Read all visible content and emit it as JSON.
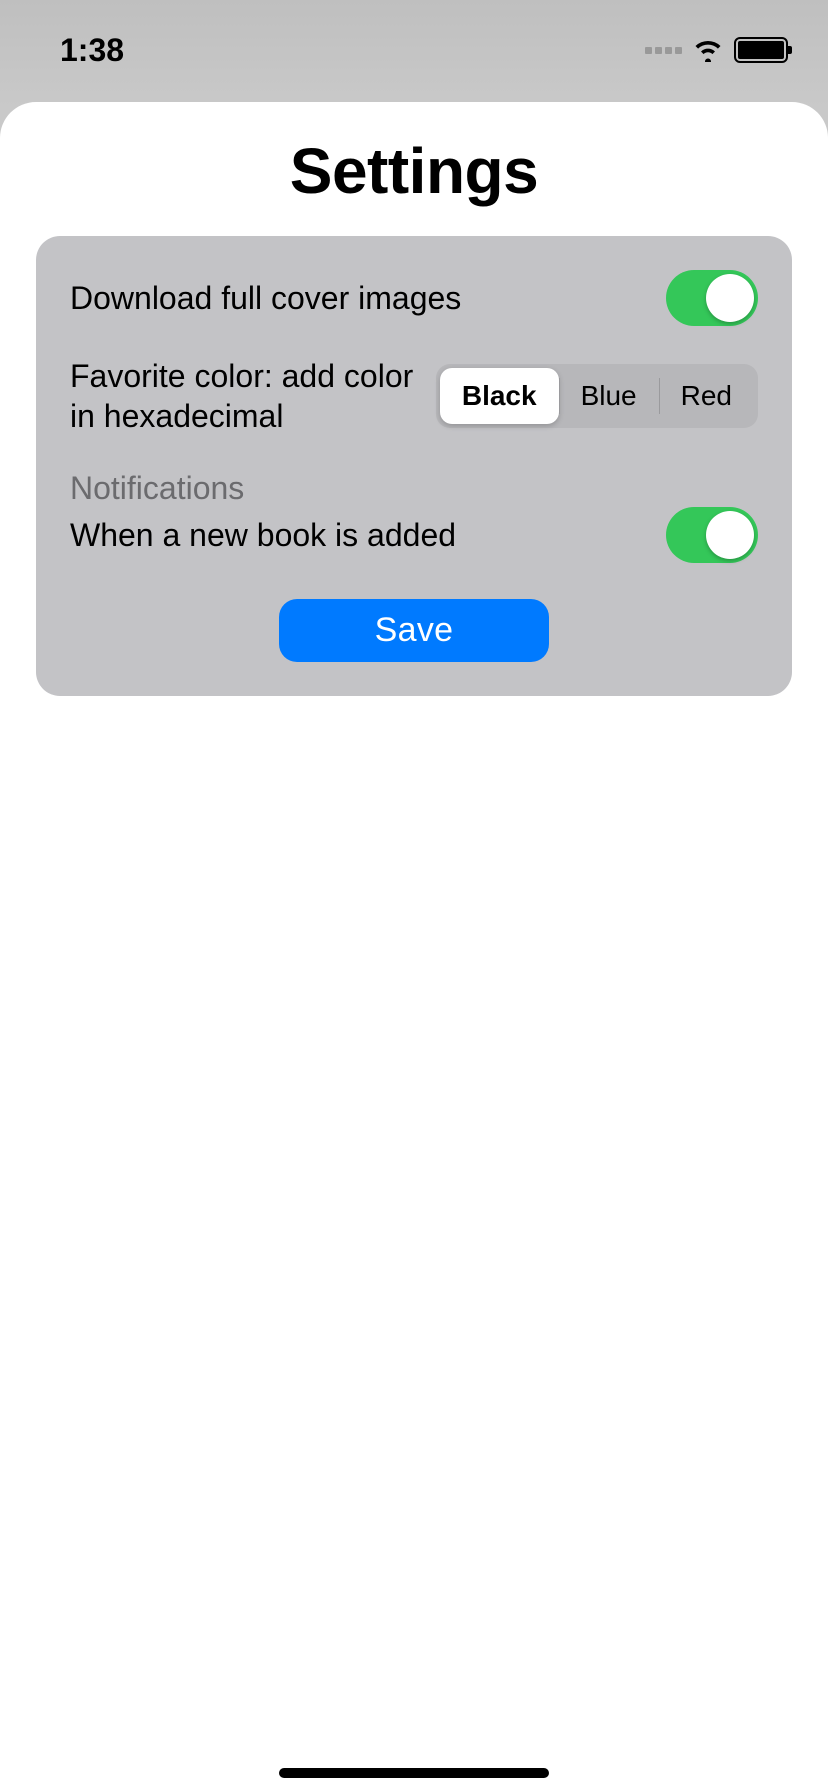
{
  "status": {
    "time": "1:38"
  },
  "page": {
    "title": "Settings"
  },
  "settings": {
    "download_full_cover": {
      "label": "Download full cover images",
      "on": true
    },
    "favorite_color": {
      "label": "Favorite color: add color in hexadecimal",
      "options": [
        "Black",
        "Blue",
        "Red"
      ],
      "selected_index": 0
    },
    "notifications_header": "Notifications",
    "new_book_added": {
      "label": "When a new book is added",
      "on": true
    },
    "save_label": "Save"
  },
  "colors": {
    "accent": "#007aff",
    "switch_on": "#34c759"
  }
}
